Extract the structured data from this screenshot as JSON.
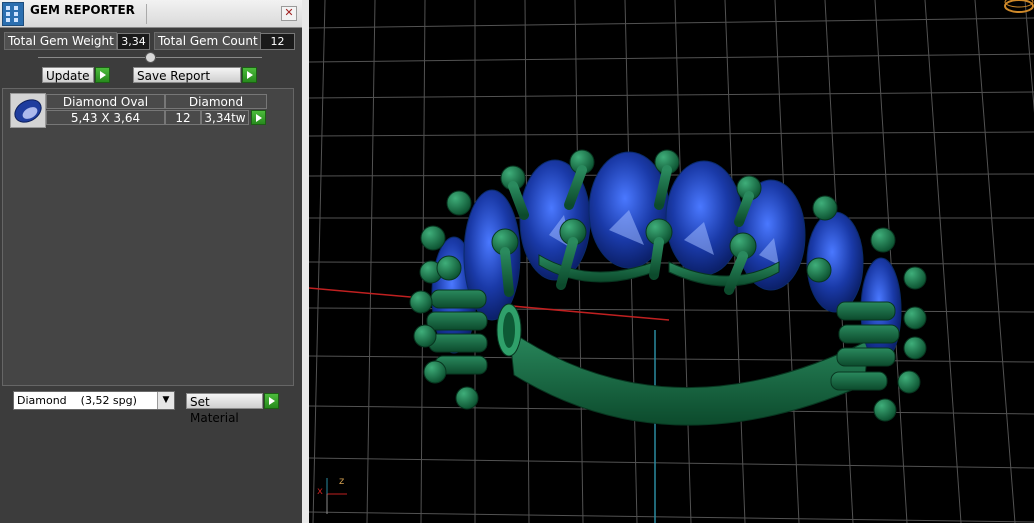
{
  "window": {
    "title": "GEM REPORTER",
    "close_glyph": "✕"
  },
  "stats": {
    "weight_label": "Total Gem Weight",
    "weight_value": "3,34",
    "count_label": "Total Gem Count",
    "count_value": "12"
  },
  "actions": {
    "update_label": "Update",
    "save_label": "Save Report"
  },
  "gem_table": {
    "icon": "oval-gem-icon",
    "row": {
      "shape": "Diamond Oval",
      "material": "Diamond",
      "size": "5,43 X 3,64",
      "count": "12",
      "weight": "3,34tw"
    }
  },
  "material": {
    "selected": "Diamond    (3,52 spg)",
    "set_label": "Set Material"
  },
  "viewport": {
    "axis_x": "x",
    "axis_z": "z"
  },
  "colors": {
    "panel": "#3c3c3c",
    "metal": "#1a6e48",
    "gem": "#1a3aa8",
    "grid": "#7a7a7a",
    "go_button": "#3aa52c"
  }
}
